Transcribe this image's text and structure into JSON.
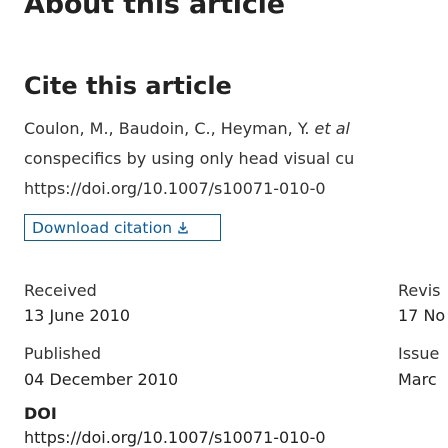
{
  "article": {
    "section_title": "About this article"
  },
  "cite": {
    "title": "Cite this article",
    "line1_authors": "Coulon, M., Baudoin, C., Heyman, Y. ",
    "line1_etal": "et al",
    "line2": "conspecifics by using only head visual cu",
    "line3": "https://doi.org/10.1007/s10071-010-0",
    "download_label": "Download citation"
  },
  "dates": {
    "received_label": "Received",
    "received_value": "13 June 2010",
    "revised_label": "Revis",
    "revised_value": "17 No",
    "published_label": "Published",
    "published_value": "04 December 2010",
    "issue_label": "Issue",
    "issue_value": "Marc"
  },
  "doi": {
    "label": "DOI",
    "value": "https://doi.org/10.1007/s10071-010-0"
  }
}
